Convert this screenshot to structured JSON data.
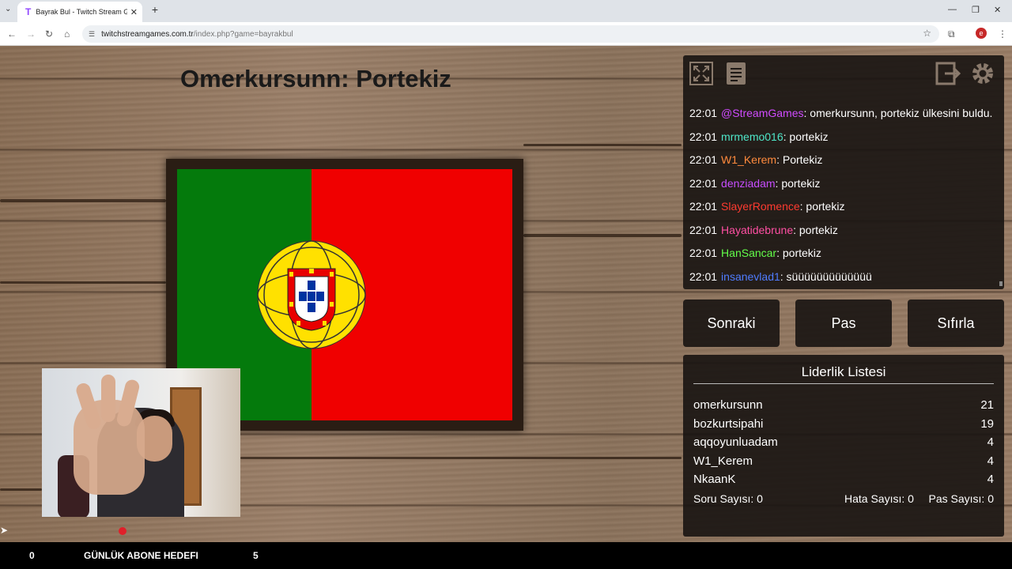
{
  "browser": {
    "tab_title": "Bayrak Bul - Twitch Stream Games",
    "tab_icon": "T",
    "new_tab": "+",
    "url_host": "twitchstreamgames.com.tr",
    "url_path": "/index.php?game=bayrakbul",
    "profile_initial": "e"
  },
  "game": {
    "headline": "Omerkursunn: Portekiz",
    "flag_colors": {
      "green": "#047a0c",
      "red": "#f00000"
    }
  },
  "chat": {
    "messages": [
      {
        "time": "22:01",
        "user": "@StreamGames",
        "color": "#d04bff",
        "text": ": omerkursunn, portekiz ülkesini buldu."
      },
      {
        "time": "22:01",
        "user": "mrmemo016",
        "color": "#4ee6c8",
        "text": ": portekiz"
      },
      {
        "time": "22:01",
        "user": "W1_Kerem",
        "color": "#ff8a3d",
        "text": ": Portekiz"
      },
      {
        "time": "22:01",
        "user": "denziadam",
        "color": "#c74dff",
        "text": ": portekiz"
      },
      {
        "time": "22:01",
        "user": "SlayerRomence",
        "color": "#ff3b30",
        "text": ": portekiz"
      },
      {
        "time": "22:01",
        "user": "Hayatidebrune",
        "color": "#ff4fa3",
        "text": ": portekiz"
      },
      {
        "time": "22:01",
        "user": "HanSancar",
        "color": "#63ff4a",
        "text": ": portekiz"
      },
      {
        "time": "22:01",
        "user": "insanevlad1",
        "color": "#4f7cff",
        "text": ": süüüüüüüüüüüüü"
      }
    ]
  },
  "controls": {
    "next": "Sonraki",
    "pass": "Pas",
    "reset": "Sıfırla"
  },
  "leaderboard": {
    "title": "Liderlik Listesi",
    "rows": [
      {
        "name": "omerkursunn",
        "score": "21"
      },
      {
        "name": "bozkurtsipahi",
        "score": "19"
      },
      {
        "name": "aqqoyunluadam",
        "score": "4"
      },
      {
        "name": "W1_Kerem",
        "score": "4"
      },
      {
        "name": "NkaanK",
        "score": "4"
      }
    ],
    "stats": {
      "questions": "Soru Sayısı: 0",
      "errors": "Hata Sayısı: 0",
      "passes": "Pas Sayısı: 0"
    }
  },
  "bottom": {
    "left_count": "0",
    "goal_label": "GÜNLÜK ABONE HEDEFI",
    "goal_value": "5"
  },
  "icons": [
    "chevron-down-icon",
    "close-icon",
    "back-icon",
    "forward-icon",
    "reload-icon",
    "home-icon",
    "site-info-icon",
    "star-icon",
    "extensions-icon",
    "menu-icon",
    "fullscreen-icon",
    "log-icon",
    "exit-icon",
    "settings-icon",
    "cursor-icon"
  ]
}
